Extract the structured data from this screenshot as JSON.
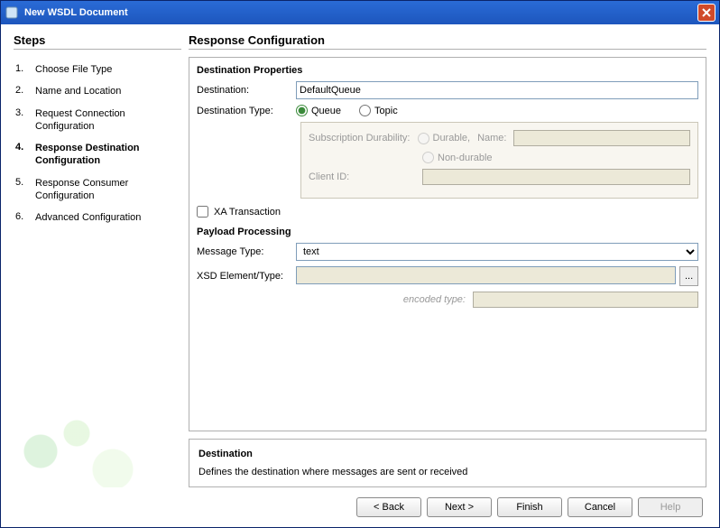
{
  "window": {
    "title": "New WSDL Document"
  },
  "sidebar": {
    "heading": "Steps",
    "items": [
      {
        "num": "1.",
        "label": "Choose File Type"
      },
      {
        "num": "2.",
        "label": "Name and Location"
      },
      {
        "num": "3.",
        "label": "Request Connection Configuration"
      },
      {
        "num": "4.",
        "label": "Response Destination Configuration",
        "active": true
      },
      {
        "num": "5.",
        "label": "Response Consumer Configuration"
      },
      {
        "num": "6.",
        "label": "Advanced Configuration"
      }
    ]
  },
  "main": {
    "heading": "Response Configuration",
    "destprops": {
      "title": "Destination Properties",
      "destination_label": "Destination:",
      "destination_value": "DefaultQueue",
      "desttype_label": "Destination Type:",
      "queue_label": "Queue",
      "topic_label": "Topic",
      "selected_type": "Queue",
      "durability_label": "Subscription Durability:",
      "durable_label": "Durable,",
      "nondurable_label": "Non-durable",
      "name_label": "Name:",
      "name_value": "",
      "clientid_label": "Client ID:",
      "clientid_value": "",
      "xa_label": "XA Transaction",
      "xa_checked": false
    },
    "payload": {
      "title": "Payload Processing",
      "msgtype_label": "Message Type:",
      "msgtype_value": "text",
      "xsd_label": "XSD Element/Type:",
      "xsd_value": "",
      "browse_label": "...",
      "encoded_label": "encoded type:",
      "encoded_value": ""
    },
    "desc": {
      "title": "Destination",
      "text": "Defines the destination where messages are sent or received"
    }
  },
  "buttons": {
    "back": "< Back",
    "next": "Next >",
    "finish": "Finish",
    "cancel": "Cancel",
    "help": "Help"
  }
}
